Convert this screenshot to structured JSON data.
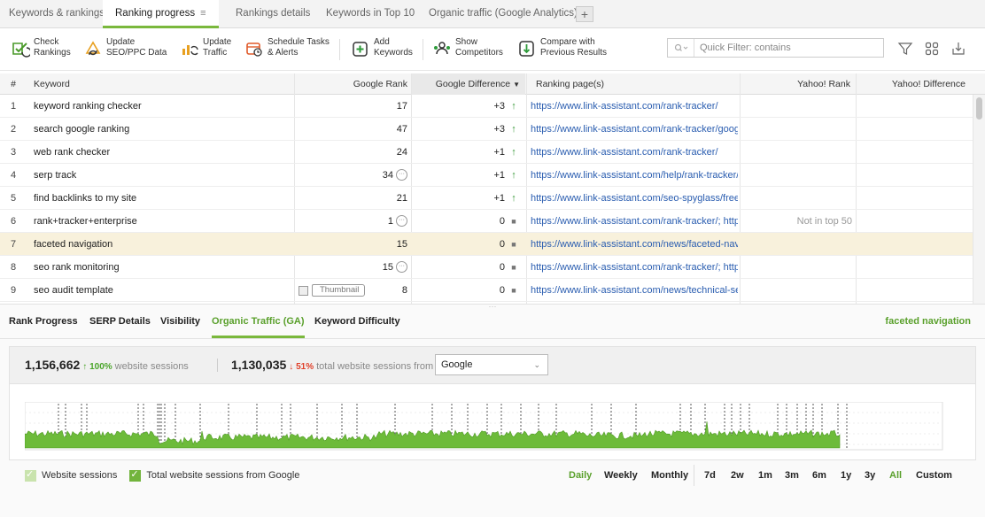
{
  "tabs": [
    {
      "label": "Keywords & rankings"
    },
    {
      "label": "Ranking progress",
      "menu": "≡"
    },
    {
      "label": "Rankings details"
    },
    {
      "label": "Keywords in Top 10"
    },
    {
      "label": "Organic traffic (Google Analytics)"
    }
  ],
  "tab_add": "+",
  "toolbar": {
    "check": [
      "Check",
      "Rankings"
    ],
    "update_seo": [
      "Update",
      "SEO/PPC Data"
    ],
    "update_traffic": [
      "Update",
      "Traffic"
    ],
    "schedule": [
      "Schedule Tasks",
      "& Alerts"
    ],
    "add_keywords": [
      "Add",
      "Keywords"
    ],
    "show_competitors": [
      "Show",
      "Competitors"
    ],
    "compare": [
      "Compare with",
      "Previous Results"
    ],
    "quick_filter_placeholder": "Quick Filter: contains"
  },
  "table": {
    "columns": {
      "num": "#",
      "keyword": "Keyword",
      "google_rank": "Google Rank",
      "google_diff": "Google Difference",
      "ranking_page": "Ranking page(s)",
      "yahoo_rank": "Yahoo! Rank",
      "yahoo_diff": "Yahoo! Difference"
    },
    "sort_indicator": "▼",
    "thumbnail_label": "Thumbnail",
    "rows": [
      {
        "num": "1",
        "keyword": "keyword ranking checker",
        "rank": "17",
        "diff": "+3",
        "trend": "up",
        "url": "https://www.link-assistant.com/rank-tracker/",
        "yahoo": ""
      },
      {
        "num": "2",
        "keyword": "search google ranking",
        "rank": "47",
        "diff": "+3",
        "trend": "up",
        "url": "https://www.link-assistant.com/rank-tracker/google-",
        "yahoo": ""
      },
      {
        "num": "3",
        "keyword": "web rank checker",
        "rank": "24",
        "diff": "+1",
        "trend": "up",
        "url": "https://www.link-assistant.com/rank-tracker/",
        "yahoo": ""
      },
      {
        "num": "4",
        "keyword": "serp track",
        "rank": "34",
        "more": true,
        "diff": "+1",
        "trend": "up",
        "url": "https://www.link-assistant.com/help/rank-tracker/tra",
        "yahoo": ""
      },
      {
        "num": "5",
        "keyword": "find backlinks to my site",
        "rank": "21",
        "diff": "+1",
        "trend": "up",
        "url": "https://www.link-assistant.com/seo-spyglass/free-b",
        "yahoo": ""
      },
      {
        "num": "6",
        "keyword": "rank+tracker+enterprise",
        "rank": "1",
        "more": true,
        "diff": "0",
        "trend": "none",
        "url": "https://www.link-assistant.com/rank-tracker/; https:/",
        "yahoo": "Not in top 50"
      },
      {
        "num": "7",
        "keyword": "faceted navigation",
        "rank": "15",
        "diff": "0",
        "trend": "none",
        "url": "https://www.link-assistant.com/news/faceted-naviga",
        "yahoo": "",
        "selected": true
      },
      {
        "num": "8",
        "keyword": "seo rank monitoring",
        "rank": "15",
        "more": true,
        "diff": "0",
        "trend": "none",
        "url": "https://www.link-assistant.com/rank-tracker/; https:/",
        "yahoo": ""
      },
      {
        "num": "9",
        "keyword": "seo audit template",
        "rank": "8",
        "thumb": true,
        "diff": "0",
        "trend": "none",
        "url": "https://www.link-assistant.com/news/technical-seo-",
        "yahoo": ""
      }
    ]
  },
  "bottom": {
    "tabs": [
      {
        "label": "Rank Progress"
      },
      {
        "label": "SERP Details"
      },
      {
        "label": "Visibility"
      },
      {
        "label": "Organic Traffic (GA)"
      },
      {
        "label": "Keyword Difficulty"
      }
    ],
    "active_tab": "Organic Traffic (GA)",
    "current_keyword": "faceted navigation",
    "stats": {
      "sessions": "1,156,662",
      "sessions_change": "↑ 100%",
      "sessions_label": "website sessions",
      "source_sessions": "1,130,035",
      "source_change": "↓ 51%",
      "source_label": "total website sessions from",
      "source_value": "Google"
    },
    "legend": {
      "website_sessions": "Website sessions",
      "google_sessions": "Total website sessions from Google"
    },
    "periods": {
      "daily": "Daily",
      "weekly": "Weekly",
      "monthly": "Monthly",
      "d7": "7d",
      "w2": "2w",
      "m1": "1m",
      "m3": "3m",
      "m6": "6m",
      "y1": "1y",
      "y3": "3y",
      "all": "All",
      "custom": "Custom"
    },
    "active_period": "Daily",
    "active_range": "All"
  },
  "colors": {
    "accent": "#7ab83c",
    "up": "#3a9a3a",
    "down": "#e0402a",
    "link": "#2a5db0",
    "selected_row": "#f8f1dc",
    "series_google": "#5fae2e",
    "series_website": "#c9e3ad"
  },
  "icons": {
    "check": "check-rankings-icon",
    "update_seo": "update-seo-icon",
    "update_traffic": "update-traffic-icon",
    "schedule": "schedule-icon",
    "add": "add-keywords-icon",
    "competitors": "competitors-icon",
    "compare": "compare-icon",
    "filter": "filter-icon",
    "view": "view-options-icon",
    "export": "export-icon"
  }
}
